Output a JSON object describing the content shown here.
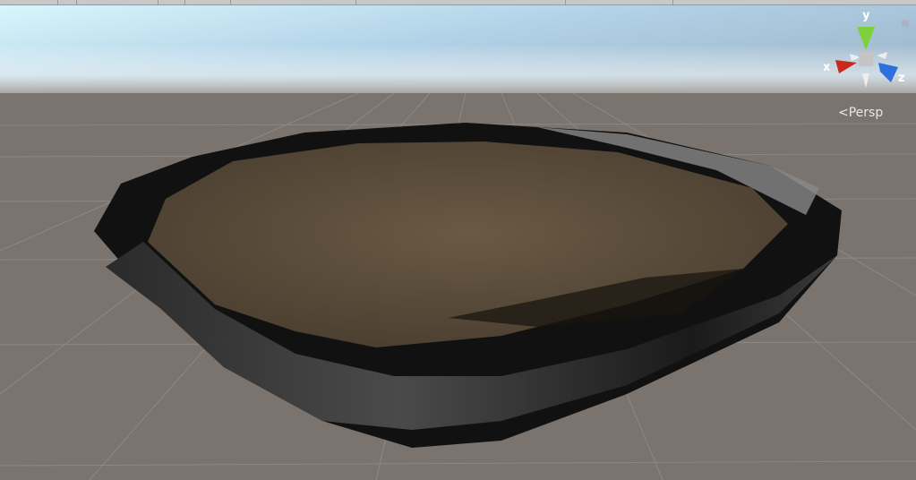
{
  "scene_view": {
    "gizmo": {
      "x_label": "x",
      "y_label": "y",
      "z_label": "z"
    },
    "projection_label": "Persp",
    "colors": {
      "x_axis": "#c8281e",
      "y_axis": "#7dd13a",
      "z_axis": "#2e6fe0",
      "ground": "#7b736d"
    }
  }
}
